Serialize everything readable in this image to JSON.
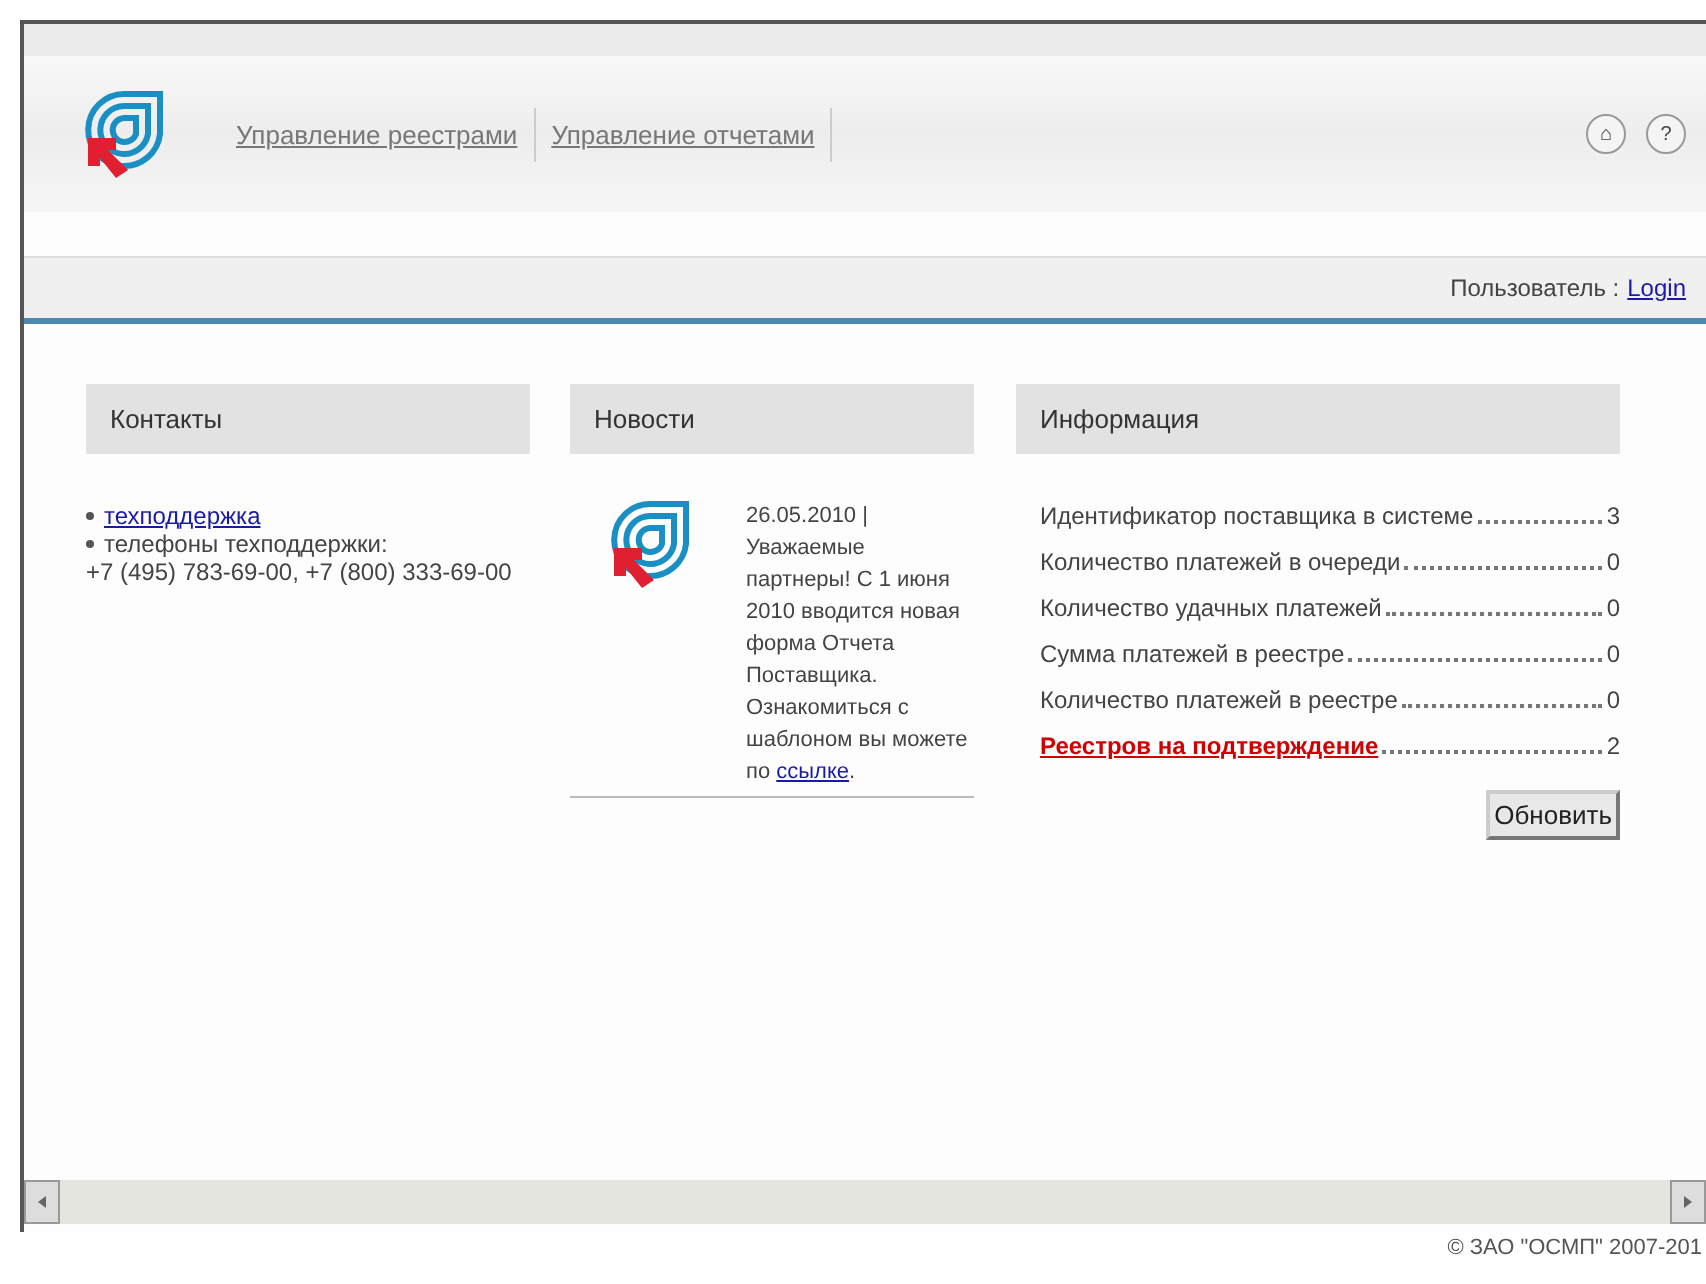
{
  "nav": [
    {
      "label": "Управление реестрами"
    },
    {
      "label": "Управление отчетами"
    }
  ],
  "header_icons": [
    "⌂",
    "?"
  ],
  "user_bar": {
    "label": "Пользователь :",
    "login": "Login"
  },
  "contacts": {
    "title": "Контакты",
    "link": "техподдержка",
    "phones_label": "телефоны техподдержки:",
    "phones": "+7 (495) 783-69-00, +7 (800) 333-69-00"
  },
  "news": {
    "title": "Новости",
    "date": "26.05.2010 |",
    "text": "Уважаемые партнеры! С 1 июня 2010 вводится новая форма Отчета Поставщика. Ознакомиться с шаблоном вы можете по",
    "link": "ссылке",
    "after": "."
  },
  "info": {
    "title": "Информация",
    "rows": [
      {
        "kind": "text",
        "label": "Идентификатор поставщика в системе",
        "value": "3"
      },
      {
        "kind": "text",
        "label": "Количество платежей в очереди",
        "value": "0"
      },
      {
        "kind": "text",
        "label": "Количество удачных платежей",
        "value": "0"
      },
      {
        "kind": "text",
        "label": "Сумма платежей в реестре",
        "value": "0"
      },
      {
        "kind": "text",
        "label": "Количество платежей в реестре",
        "value": "0"
      },
      {
        "kind": "link",
        "label": "Реестров на подтверждение",
        "value": "2"
      }
    ],
    "button": "Обновить"
  },
  "footer": "© ЗАО \"ОСМП\" 2007-201"
}
